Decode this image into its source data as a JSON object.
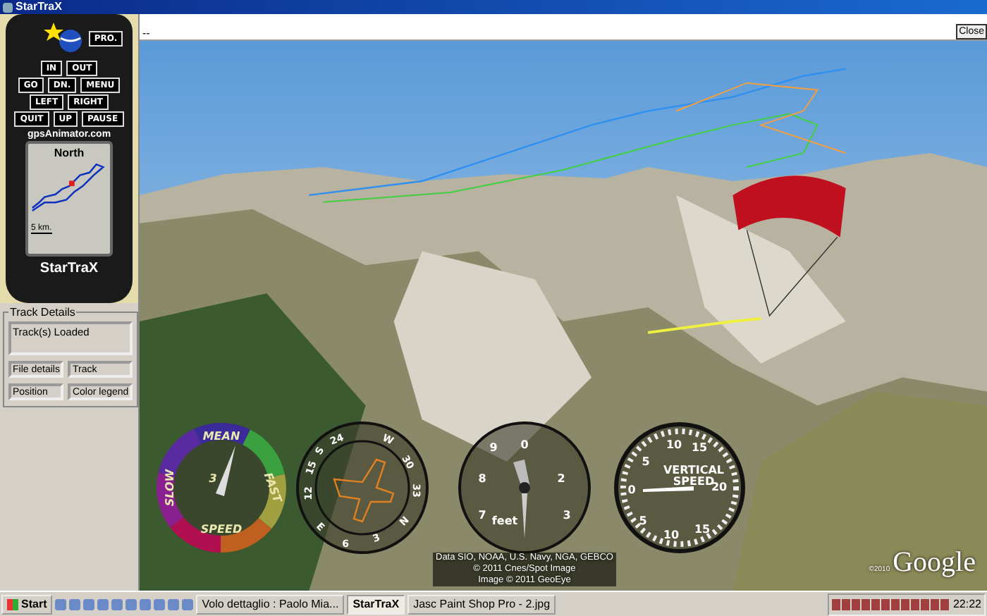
{
  "window": {
    "title": "StarTraX"
  },
  "device": {
    "pro_button": "PRO.",
    "button_rows": [
      [
        "IN",
        "OUT"
      ],
      [
        "GO",
        "DN.",
        "MENU"
      ],
      [
        "LEFT",
        "RIGHT"
      ],
      [
        "QUIT",
        "UP",
        "PAUSE"
      ]
    ],
    "website": "gpsAnimator.com",
    "map": {
      "heading": "North",
      "scale": "5 km."
    },
    "name": "StarTraX"
  },
  "track_details": {
    "legend": "Track Details",
    "status": "Track(s) Loaded",
    "buttons": [
      "File details",
      "Track",
      "Position",
      "Color legend"
    ]
  },
  "viewer": {
    "toolbar_text": "--",
    "close_button": "Close",
    "gauges": [
      {
        "kind": "speed",
        "labels": [
          "MEAN",
          "FAST",
          "SPEED",
          "SLOW",
          "3"
        ]
      },
      {
        "kind": "compass",
        "labels": [
          "24",
          "W",
          "30",
          "33",
          "N",
          "3",
          "6",
          "E",
          "12",
          "15",
          "S"
        ]
      },
      {
        "kind": "altimeter",
        "labels": [
          "0",
          "9",
          "8",
          "2",
          "7",
          "feet",
          "3"
        ]
      },
      {
        "kind": "vario",
        "labels": [
          "10",
          "15",
          "20",
          "15",
          "10",
          "5",
          "0",
          "5",
          "VERTICAL",
          "SPEED"
        ]
      }
    ],
    "attribution": [
      "Data SIO, NOAA, U.S. Navy, NGA, GEBCO",
      "© 2011 Cnes/Spot Image",
      "Image © 2011 GeoEye"
    ],
    "logo_year": "©2010",
    "logo": "Google"
  },
  "taskbar": {
    "start": "Start",
    "tasks": [
      {
        "label": "Volo dettaglio : Paolo Mia...",
        "selected": false
      },
      {
        "label": "StarTraX",
        "selected": true
      },
      {
        "label": "Jasc Paint Shop Pro - 2.jpg",
        "selected": false
      }
    ],
    "clock": "22:22"
  }
}
